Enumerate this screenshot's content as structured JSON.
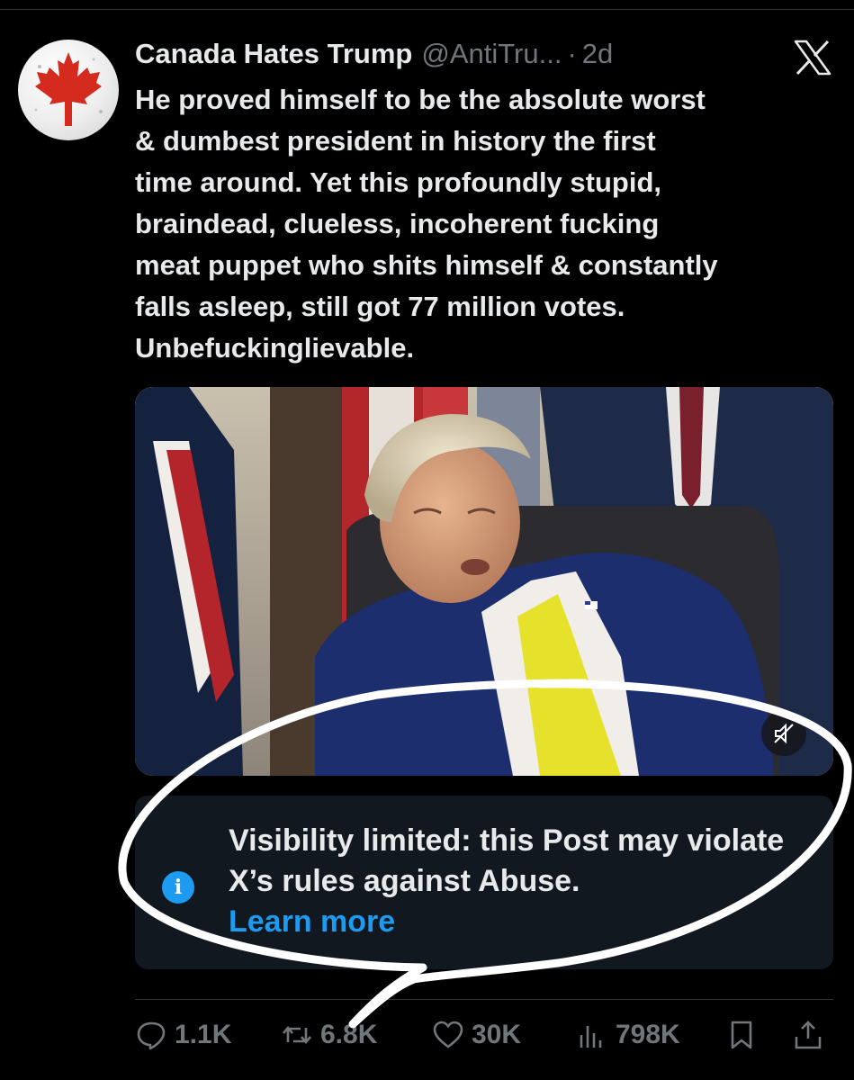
{
  "post": {
    "display_name": "Canada Hates Trump",
    "handle": "@AntiTru...",
    "separator": "·",
    "time": "2d",
    "text": "He proved himself to be the absolute worst\n& dumbest president in history the first\ntime around. Yet this profoundly stupid,\nbraindead, clueless, incoherent fucking\nmeat puppet who shits himself & constantly\nfalls asleep, still got 77 million votes.\nUnbefuckinglievable."
  },
  "notice": {
    "text": "Visibility limited: this Post may violate X’s rules against Abuse.",
    "link": "Learn more",
    "icon": "info-icon"
  },
  "actions": {
    "replies": "1.1K",
    "reposts": "6.8K",
    "likes": "30K",
    "views": "798K"
  },
  "icons": {
    "avatar": "maple-leaf-icon",
    "brand": "x-logo-icon",
    "mute": "volume-muted-icon",
    "reply": "reply-icon",
    "repost": "repost-icon",
    "like": "heart-icon",
    "views": "bar-chart-icon",
    "bookmark": "bookmark-icon",
    "share": "share-icon"
  },
  "colors": {
    "background": "#000000",
    "text": "#e7e9ea",
    "muted": "#71767b",
    "accent": "#1d9bf0",
    "notice_bg": "#111820",
    "avatar_leaf": "#d52b1e"
  }
}
